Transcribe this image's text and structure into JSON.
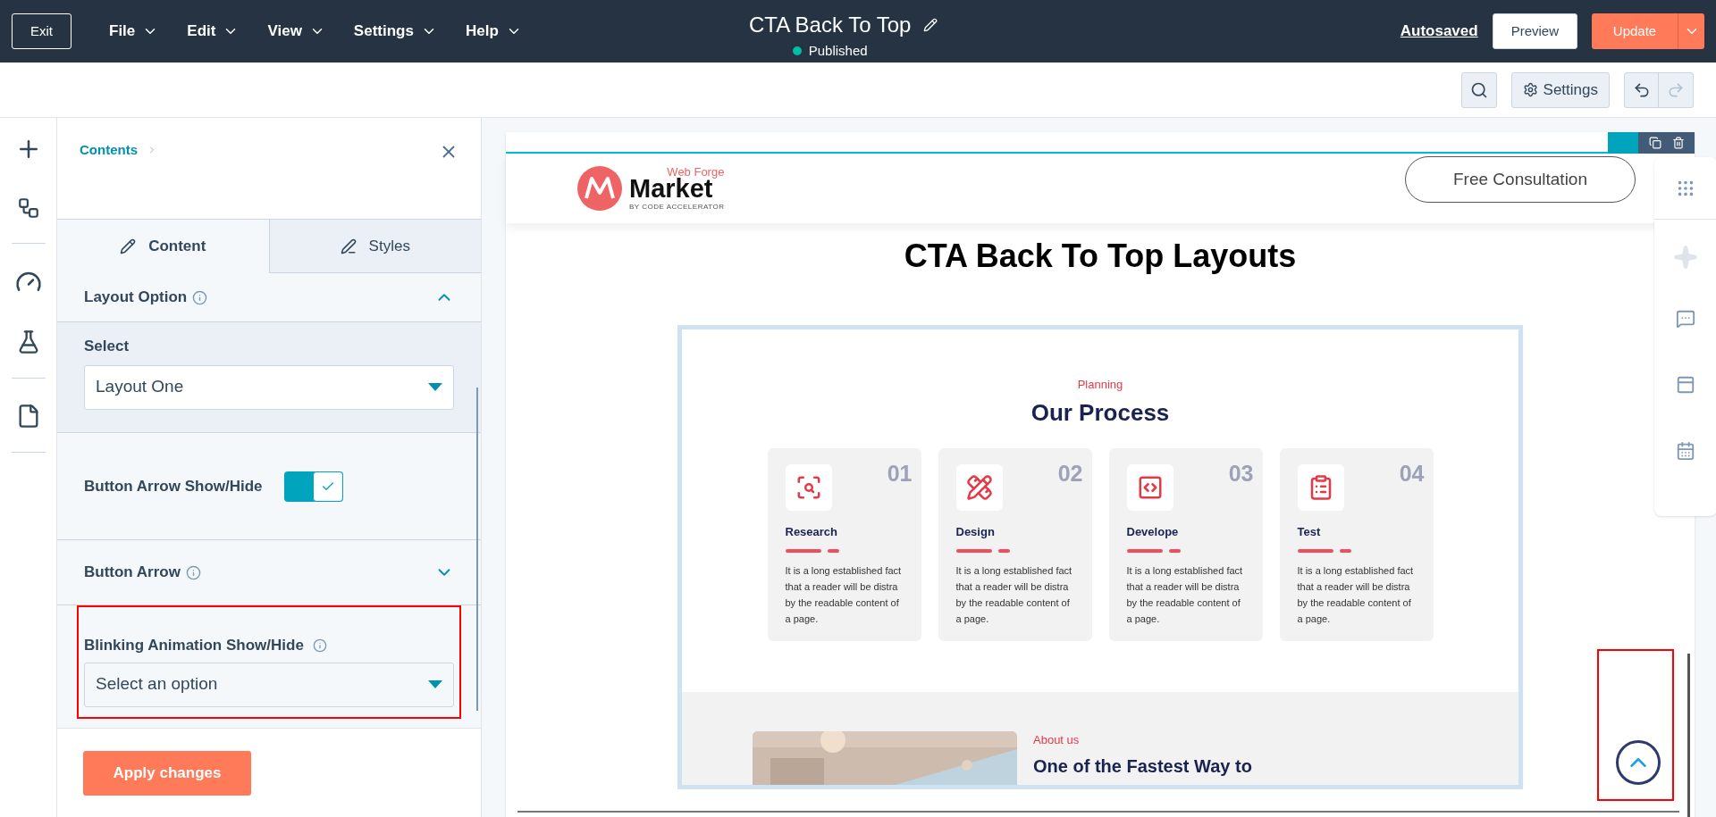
{
  "top_bar": {
    "exit": "Exit",
    "menus": [
      {
        "label": "File"
      },
      {
        "label": "Edit"
      },
      {
        "label": "View"
      },
      {
        "label": "Settings"
      },
      {
        "label": "Help"
      }
    ],
    "title": "CTA Back To Top",
    "status": "Published",
    "autosaved": "Autosaved",
    "preview": "Preview",
    "update": "Update"
  },
  "toolbar": {
    "settings": "Settings"
  },
  "panel": {
    "breadcrumb": "Contents",
    "tabs": [
      {
        "label": "Content",
        "selected": true
      },
      {
        "label": "Styles",
        "selected": false
      }
    ],
    "layout_option": {
      "label": "Layout Option",
      "expanded": true
    },
    "select": {
      "label": "Select",
      "value": "Layout One"
    },
    "arrow_toggle": {
      "label": "Button Arrow Show/Hide",
      "on": true
    },
    "button_arrow": {
      "label": "Button Arrow",
      "expanded": false
    },
    "blinking": {
      "label": "Blinking Animation Show/Hide",
      "placeholder": "Select an option"
    },
    "apply": "Apply changes"
  },
  "preview": {
    "logo": {
      "tag": "Web Forge",
      "name": "Market",
      "byline": "BY CODE ACCELERATOR"
    },
    "cta": "Free Consultation",
    "heading": "CTA Back To Top Layouts",
    "process": {
      "eyebrow": "Planning",
      "title": "Our Process",
      "cards": [
        {
          "number": "01",
          "title": "Research",
          "text": "It is a long established fact that a reader will be distra by the readable content of a page.",
          "kind": "research"
        },
        {
          "number": "02",
          "title": "Design",
          "text": "It is a long established fact that a reader will be distra by the readable content of a page.",
          "kind": "design"
        },
        {
          "number": "03",
          "title": "Develope",
          "text": "It is a long established fact that a reader will be distra by the readable content of a page.",
          "kind": "develop"
        },
        {
          "number": "04",
          "title": "Test",
          "text": "It is a long established fact that a reader will be distra by the readable content of a page.",
          "kind": "test"
        }
      ]
    },
    "about": {
      "eyebrow": "About us",
      "title": "One of the Fastest Way to"
    }
  }
}
